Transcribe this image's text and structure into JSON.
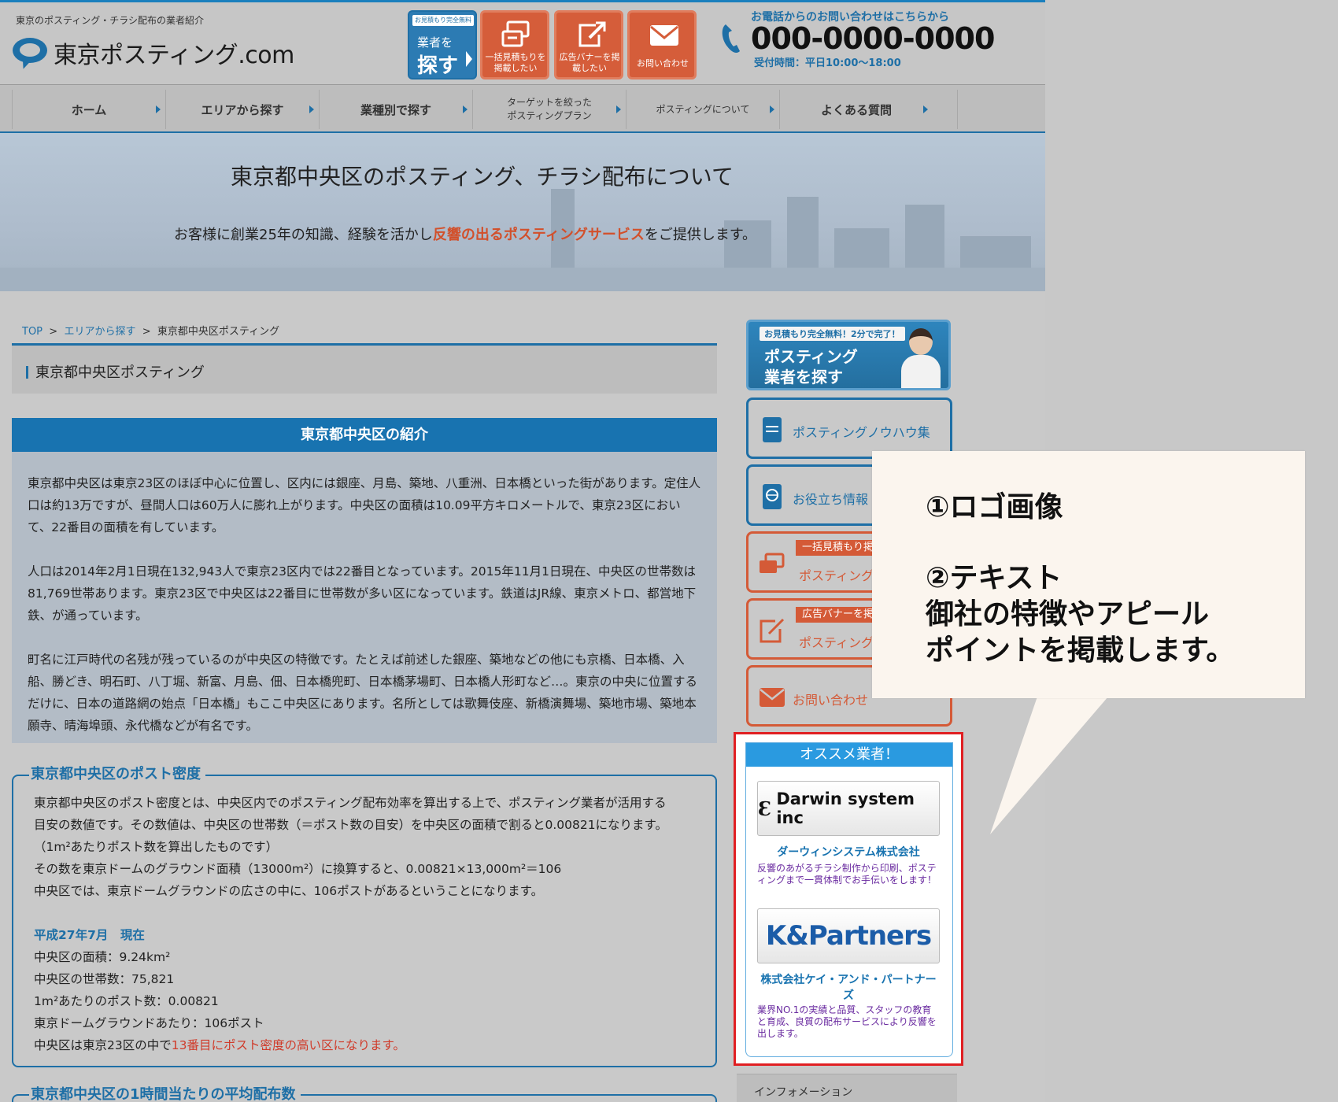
{
  "header": {
    "tagline": "東京のポスティング・チラシ配布の業者紹介",
    "logo_text": "東京ポスティング.com",
    "search_btn": {
      "badge": "お見積もり完全無料",
      "line1": "業者を",
      "line2": "探す"
    },
    "quote_btn": {
      "label": "一括見積もりを掲載したい"
    },
    "banner_btn": {
      "label": "広告バナーを掲載したい"
    },
    "contact_btn": {
      "label": "お問い合わせ"
    },
    "phone_label": "お電話からのお問い合わせはこちらから",
    "phone_number": "000-0000-0000",
    "phone_hours": "受付時間：平日10:00～18:00"
  },
  "nav": {
    "items": [
      {
        "label": "ホーム"
      },
      {
        "label": "エリアから探す"
      },
      {
        "label": "業種別で探す"
      },
      {
        "label": "ターゲットを絞った\nポスティングプラン"
      },
      {
        "label": "ポスティングについて"
      },
      {
        "label": "よくある質問"
      }
    ]
  },
  "hero": {
    "title": "東京都中央区のポスティング、チラシ配布について",
    "sub_before": "お客様に創業25年の知識、経験を活かし",
    "sub_highlight": "反響の出るポスティングサービス",
    "sub_after": "をご提供します。"
  },
  "breadcrumb": {
    "top": "TOP",
    "sep": ">",
    "area": "エリアから探す",
    "current": "東京都中央区ポスティング"
  },
  "page_title": "東京都中央区ポスティング",
  "intro": {
    "heading": "東京都中央区の紹介",
    "paragraphs": [
      "東京都中央区は東京23区のほぼ中心に位置し、区内には銀座、月島、築地、八重洲、日本橋といった街があります。定住人口は約13万ですが、昼間人口は60万人に膨れ上がります。中央区の面積は10.09平方キロメートルで、東京23区において、22番目の面積を有しています。",
      "人口は2014年2月1日現在132,943人で東京23区内では22番目となっています。2015年11月1日現在、中央区の世帯数は81,769世帯あります。東京23区で中央区は22番目に世帯数が多い区になっています。鉄道はJR線、東京メトロ、都営地下鉄、が通っています。",
      "町名に江戸時代の名残が残っているのが中央区の特徴です。たとえば前述した銀座、築地などの他にも京橋、日本橋、入船、勝どき、明石町、八丁堀、新富、月島、佃、日本橋兜町、日本橋茅場町、日本橋人形町など…。東京の中央に位置するだけに、日本の道路網の始点「日本橋」もここ中央区にあります。名所としては歌舞伎座、新橋演舞場、築地市場、築地本願寺、晴海埠頭、永代橋などが有名です。"
    ]
  },
  "density": {
    "heading": "東京都中央区のポスト密度",
    "lines": [
      "東京都中央区のポスト密度とは、中央区内でのポスティング配布効率を算出する上で、ポスティング業者が活用する",
      "目安の数値です。その数値は、中央区の世帯数（＝ポスト数の目安）を中央区の面積で割ると0.00821になります。",
      "（1m²あたりポスト数を算出したものです）",
      "その数を東京ドームのグラウンド面積（13000m²）に換算すると、0.00821×13,000m²＝106",
      "中央区では、東京ドームグラウンドの広さの中に、106ポストがあるということになります。"
    ],
    "date": "平成27年7月　現在",
    "stats": [
      "中央区の面積：9.24km²",
      "中央区の世帯数：75,821",
      "1m²あたりのポスト数：0.00821",
      "東京ドームグラウンドあたり：106ポスト"
    ],
    "last_before": "中央区は東京23区の中で",
    "last_red": "13番目にポスト密度の高い区になります。"
  },
  "hourly": {
    "heading": "東京都中央区の1時間当たりの平均配布数"
  },
  "sidebar": {
    "banner": {
      "top": "お見積もり完全無料！2分で完了！",
      "line1": "ポスティング",
      "line2": "業者を探す"
    },
    "cards": [
      {
        "label": "ポスティングノウハウ集"
      },
      {
        "label": "お役立ち情報"
      },
      {
        "tag": "一括見積もり掲",
        "label": "ポスティング"
      },
      {
        "tag": "広告バナーを掲",
        "label": "ポスティング"
      },
      {
        "label": "お問い合わせ"
      }
    ],
    "reco": {
      "heading": "オススメ業者！",
      "companies": [
        {
          "logo": "Darwin system inc",
          "name": "ダーウィンシステム株式会社",
          "desc": "反響のあがるチラシ制作から印刷、ポスティングまで一貫体制でお手伝いをします！"
        },
        {
          "logo": "K&Partners",
          "name": "株式会社ケイ・アンド・パートナーズ",
          "desc": "業界NO.1の実績と品質、スタッフの教育と育成、良質の配布サービスにより反響を出します。"
        }
      ]
    },
    "info_tab": "インフォメーション"
  },
  "callout": {
    "line1": "①ロゴ画像",
    "line2": "②テキスト",
    "line3": "御社の特徴やアピール",
    "line4": "ポイントを掲載します。"
  },
  "colors": {
    "brand_blue": "#1e6fa6",
    "accent_orange": "#d45a37",
    "highlight_red": "#e01f22"
  }
}
